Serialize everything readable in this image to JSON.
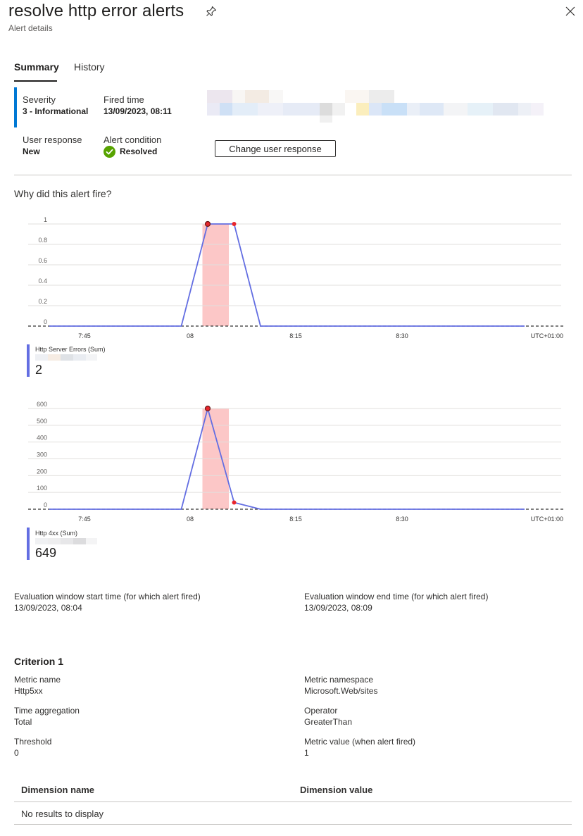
{
  "header": {
    "title": "resolve http error alerts",
    "subtitle": "Alert details"
  },
  "tabs": [
    {
      "label": "Summary",
      "active": true
    },
    {
      "label": "History",
      "active": false
    }
  ],
  "summary": {
    "severity_label": "Severity",
    "severity_value": "3 - Informational",
    "fired_label": "Fired time",
    "fired_value": "13/09/2023, 08:11",
    "user_response_label": "User response",
    "user_response_value": "New",
    "condition_label": "Alert condition",
    "condition_value": "Resolved",
    "change_button": "Change user response"
  },
  "why_title": "Why did this alert fire?",
  "colors": {
    "accent": "#0078d4",
    "series": "#636ee2",
    "highlight": "#fcc7c7",
    "point": "#e8262d",
    "resolved": "#57a300"
  },
  "chart_data": [
    {
      "type": "line",
      "y_ticks": [
        "1",
        "0.8",
        "0.6",
        "0.4",
        "0.2",
        "0"
      ],
      "x_ticks": [
        "7:45",
        "08",
        "8:15",
        "8:30",
        "UTC+01:00"
      ],
      "x": [
        "7:35",
        "7:40",
        "7:45",
        "7:50",
        "7:55",
        "8:00",
        "8:05",
        "8:10",
        "8:15",
        "8:20",
        "8:25",
        "8:30",
        "8:35",
        "8:40",
        "8:45",
        "8:50",
        "8:55",
        "9:00",
        "9:05",
        "9:10"
      ],
      "series": [
        {
          "name": "Http Server Errors (Sum)",
          "values": [
            0,
            0,
            0,
            0,
            0,
            0,
            1,
            1,
            0,
            0,
            0,
            0,
            0,
            0,
            0,
            0,
            0,
            0,
            0,
            0
          ]
        }
      ],
      "ylim": [
        0,
        1
      ],
      "highlight_window": [
        "8:04",
        "8:09"
      ],
      "threshold": 0,
      "legend_label": "Http Server Errors (Sum)",
      "legend_value": "2"
    },
    {
      "type": "line",
      "y_ticks": [
        "600",
        "500",
        "400",
        "300",
        "200",
        "100",
        "0"
      ],
      "x_ticks": [
        "7:45",
        "08",
        "8:15",
        "8:30",
        "UTC+01:00"
      ],
      "x": [
        "7:35",
        "7:40",
        "7:45",
        "7:50",
        "7:55",
        "8:00",
        "8:05",
        "8:10",
        "8:15",
        "8:20",
        "8:25",
        "8:30",
        "8:35",
        "8:40",
        "8:45",
        "8:50",
        "8:55",
        "9:00",
        "9:05",
        "9:10"
      ],
      "series": [
        {
          "name": "Http 4xx (Sum)",
          "values": [
            0,
            0,
            0,
            0,
            0,
            0,
            600,
            40,
            0,
            0,
            0,
            0,
            0,
            0,
            0,
            0,
            0,
            0,
            0,
            0
          ]
        }
      ],
      "ylim": [
        0,
        600
      ],
      "highlight_window": [
        "8:04",
        "8:09"
      ],
      "threshold": 0,
      "legend_label": "Http 4xx (Sum)",
      "legend_value": "649"
    }
  ],
  "evaluation": {
    "start_label": "Evaluation window start time (for which alert fired)",
    "start_value": "13/09/2023, 08:04",
    "end_label": "Evaluation window end time (for which alert fired)",
    "end_value": "13/09/2023, 08:09"
  },
  "criterion": {
    "title": "Criterion 1",
    "metric_name_label": "Metric name",
    "metric_name_value": "Http5xx",
    "namespace_label": "Metric namespace",
    "namespace_value": "Microsoft.Web/sites",
    "aggregation_label": "Time aggregation",
    "aggregation_value": "Total",
    "operator_label": "Operator",
    "operator_value": "GreaterThan",
    "threshold_label": "Threshold",
    "threshold_value": "0",
    "metric_value_label": "Metric value (when alert fired)",
    "metric_value_value": "1"
  },
  "dimensions": {
    "col_name": "Dimension name",
    "col_value": "Dimension value",
    "empty": "No results to display"
  }
}
